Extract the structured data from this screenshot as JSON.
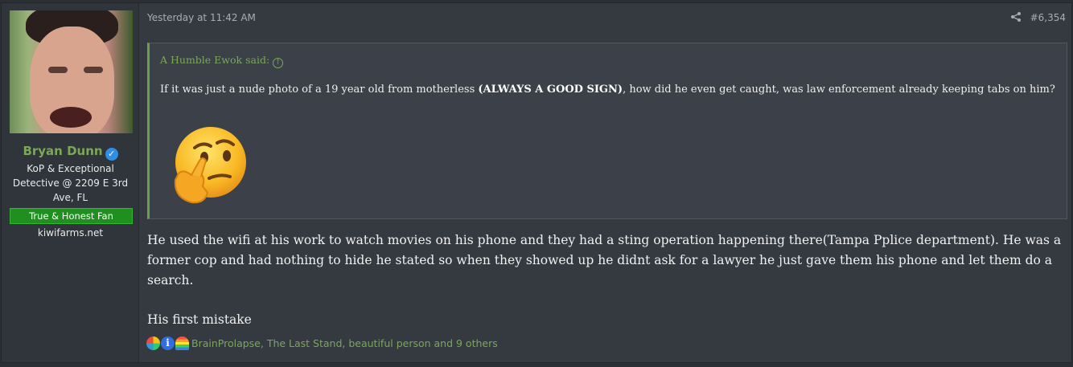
{
  "user": {
    "name": "Bryan Dunn",
    "title": "KoP & Exceptional Detective @ 2209 E 3rd Ave, FL",
    "banner": "True & Honest Fan",
    "site": "kiwifarms.net",
    "verified_color": "#2f8ee6"
  },
  "post": {
    "timestamp": "Yesterday at 11:42 AM",
    "number": "#6,354",
    "share_icon": "share-icon"
  },
  "quote": {
    "author_line": "A Humble Ewok said:",
    "text_before": "If it was just a nude photo of a 19 year old from motherless ",
    "text_bold": "(ALWAYS A GOOD SIGN)",
    "text_after": ", how did he even get caught, was law enforcement already keeping tabs on him?",
    "emoji": "thinking-face-emoji"
  },
  "message": {
    "paragraph1": "He used the wifi at his work to watch movies on his phone and they had a sting operation happening there(Tampa Pplice department). He was a former cop and had nothing to hide he stated so when they showed up he didnt ask for a lawyer he just gave them his phone and let them do a search.",
    "paragraph2": "His first mistake"
  },
  "reactions": {
    "text": "BrainProlapse, The Last Stand, beautiful person and 9 others",
    "icons": [
      "autism-puzzle-icon",
      "informative-icon",
      "rainbow-icon"
    ]
  },
  "colors": {
    "accent_green": "#7aa856",
    "banner_green": "#1f8f1f",
    "background": "#353a41"
  }
}
